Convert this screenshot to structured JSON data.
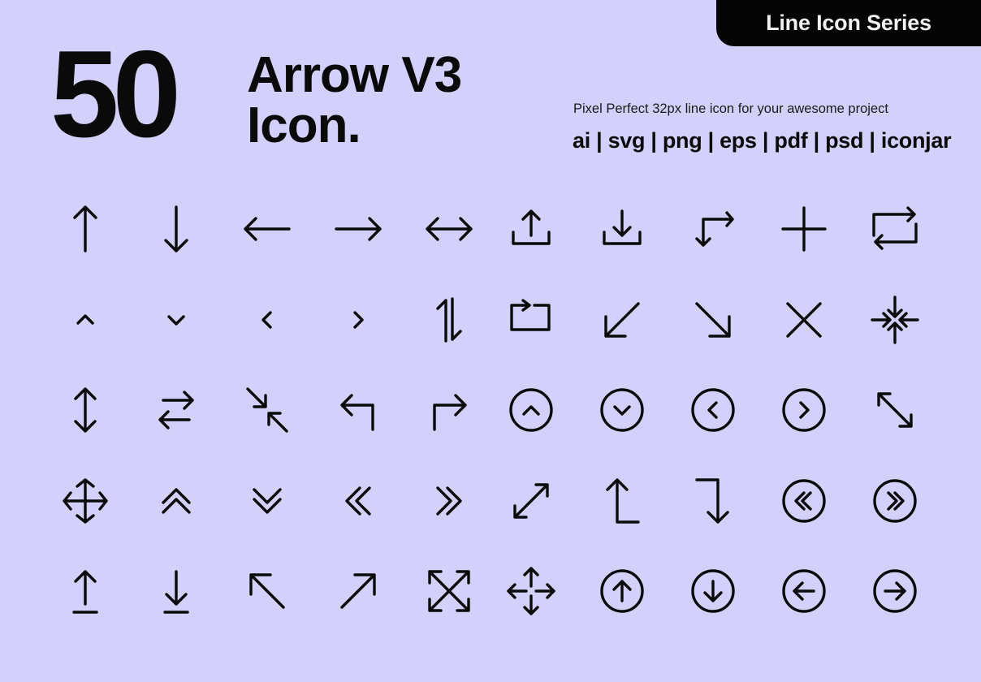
{
  "badge": {
    "label": "Line Icon Series"
  },
  "hero": {
    "count": "50",
    "title_line1": "Arrow V3",
    "title_line2": "Icon."
  },
  "subtitle": "Pixel Perfect 32px line icon for your awesome project",
  "formats": "ai | svg | png | eps | pdf | psd | iconjar",
  "colors": {
    "background": "#d3d1fb",
    "badge_bg": "#050505",
    "badge_text": "#f1f1f1",
    "ink": "#0a0a0a"
  },
  "icons": [
    [
      "arrow-up",
      "arrow-down",
      "arrow-left",
      "arrow-right",
      "arrow-left-right",
      "upload",
      "download",
      "corner-arrows",
      "plus",
      "repeat"
    ],
    [
      "chevron-up",
      "chevron-down",
      "chevron-left",
      "chevron-right",
      "arrows-up-down-swap",
      "share-box",
      "arrow-down-left",
      "arrow-down-right",
      "close-x",
      "collapse-all"
    ],
    [
      "arrow-up-down",
      "arrows-exchange",
      "minimize-diagonal",
      "arrow-return-left",
      "arrow-return-right",
      "circle-chevron-up",
      "circle-chevron-down",
      "circle-chevron-left",
      "circle-chevron-right",
      "expand-diagonal-nw-se"
    ],
    [
      "move-diamond",
      "double-chevron-up",
      "double-chevron-down",
      "double-chevron-left",
      "double-chevron-right",
      "expand-diagonal-ne-sw",
      "arrow-corner-up",
      "arrow-corner-down",
      "circle-double-chevron-left",
      "circle-double-chevron-right"
    ],
    [
      "arrow-up-to-line",
      "arrow-down-to-line",
      "arrow-up-left",
      "arrow-up-right",
      "fullscreen-box",
      "move-arrows",
      "circle-arrow-up",
      "circle-arrow-down",
      "circle-arrow-left",
      "circle-arrow-right"
    ]
  ]
}
